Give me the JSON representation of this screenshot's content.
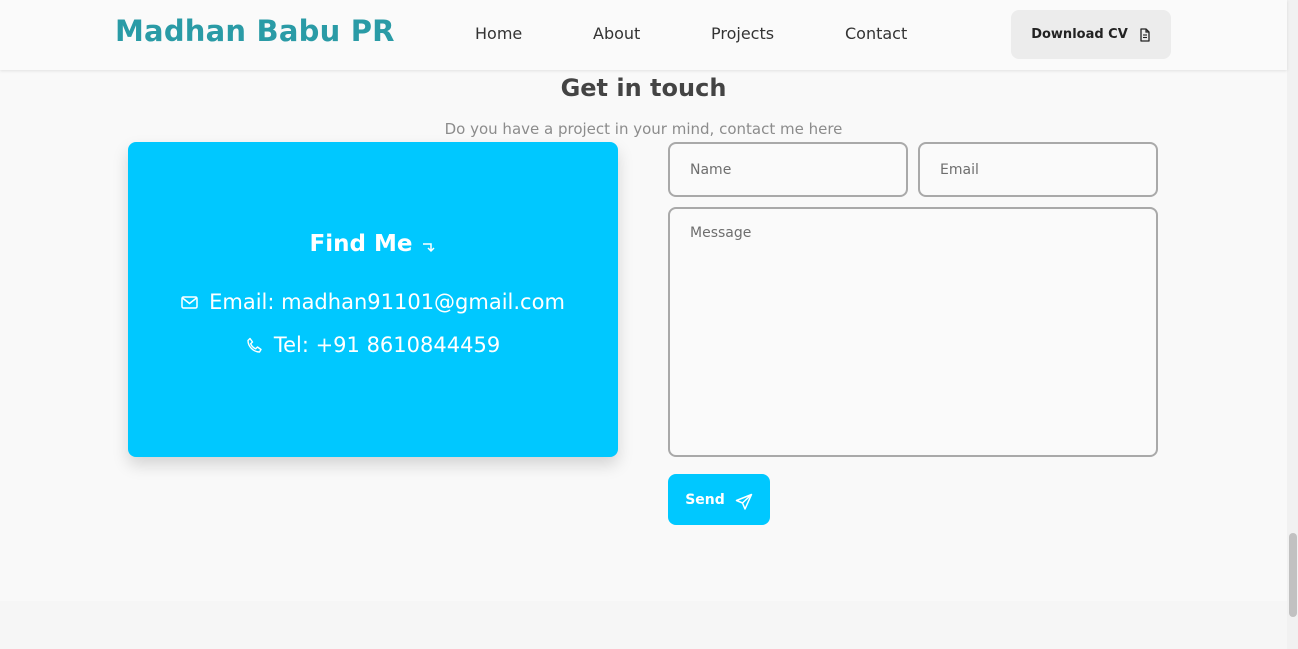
{
  "header": {
    "logo": "Madhan Babu PR",
    "nav": [
      "Home",
      "About",
      "Projects",
      "Contact"
    ],
    "cv_button": "Download CV",
    "cv_icon": "document-icon"
  },
  "contact": {
    "title": "Get in touch",
    "subtitle": "Do you have a project in your mind, contact me here",
    "card": {
      "title": "Find Me",
      "title_icon": "arrow-return-icon",
      "email": "Email: madhan91101@gmail.com",
      "email_icon": "mail-icon",
      "phone": "Tel: +91 8610844459",
      "phone_icon": "phone-icon"
    },
    "form": {
      "name_placeholder": "Name",
      "email_placeholder": "Email",
      "message_placeholder": "Message",
      "send_label": "Send",
      "send_icon": "send-icon"
    }
  },
  "colors": {
    "brand": "#2a9ba6",
    "accent": "#00c8ff",
    "background": "#f9f9f9"
  }
}
